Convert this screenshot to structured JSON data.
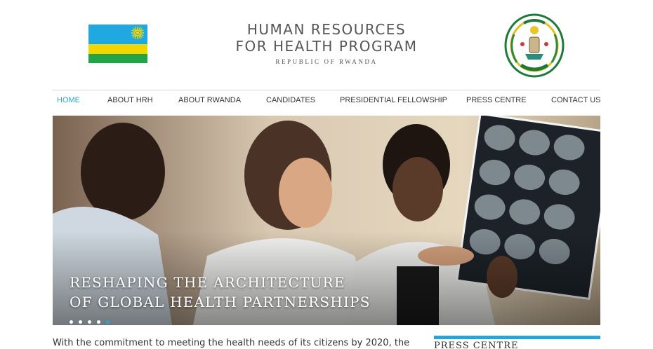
{
  "header": {
    "title_line1": "HUMAN RESOURCES",
    "title_line2": "FOR HEALTH PROGRAM",
    "subtitle": "REPUBLIC OF RWANDA",
    "flag_icon": "rwanda-flag-icon",
    "seal_icon": "rwanda-coat-of-arms-icon"
  },
  "nav": {
    "items": [
      {
        "label": "HOME",
        "active": true
      },
      {
        "label": "ABOUT HRH"
      },
      {
        "label": "ABOUT RWANDA"
      },
      {
        "label": "CANDIDATES"
      },
      {
        "label": "PRESIDENTIAL FELLOWSHIP"
      },
      {
        "label": "PRESS CENTRE"
      },
      {
        "label": "CONTACT US"
      }
    ]
  },
  "hero": {
    "caption_line1": "RESHAPING THE ARCHITECTURE",
    "caption_line2": "OF GLOBAL HEALTH PARTNERSHIPS",
    "slide_count": 5,
    "active_slide": 5
  },
  "intro": {
    "text": "With the commitment to meeting the health needs of its citizens by 2020, the"
  },
  "sidebar": {
    "press_title": "PRESS CENTRE"
  },
  "colors": {
    "accent": "#2aa3d9",
    "flag_blue": "#20a9e0",
    "flag_yellow": "#f3d500",
    "flag_green": "#22a54a"
  }
}
